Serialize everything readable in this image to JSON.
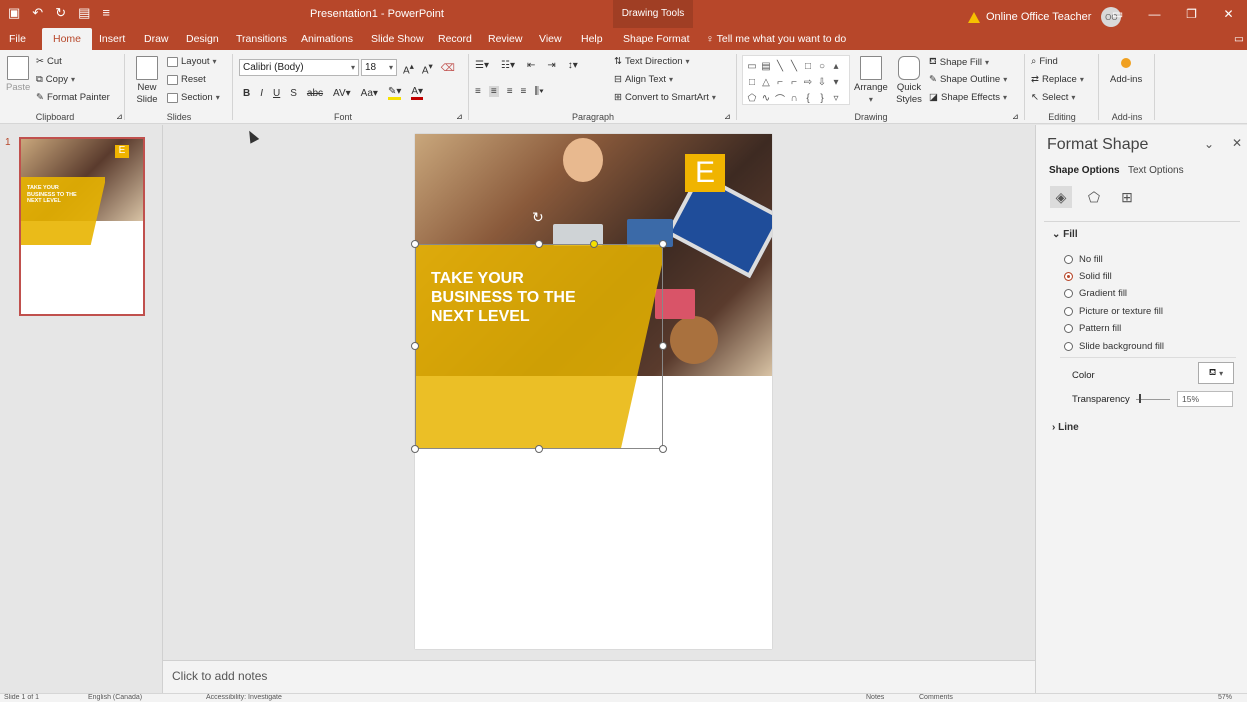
{
  "titlebar": {
    "doc_title": "Presentation1 - PowerPoint",
    "tool_group": "Drawing Tools",
    "user_name": "Online Office Teacher",
    "user_initials": "OO"
  },
  "tabs": [
    {
      "label": "File"
    },
    {
      "label": "Home",
      "active": true
    },
    {
      "label": "Insert"
    },
    {
      "label": "Draw"
    },
    {
      "label": "Design"
    },
    {
      "label": "Transitions"
    },
    {
      "label": "Animations"
    },
    {
      "label": "Slide Show"
    },
    {
      "label": "Record"
    },
    {
      "label": "Review"
    },
    {
      "label": "View"
    },
    {
      "label": "Help"
    },
    {
      "label": "Shape Format"
    }
  ],
  "tell_me": "Tell me what you want to do",
  "ribbon": {
    "clipboard": {
      "paste": "Paste",
      "cut": "Cut",
      "copy": "Copy",
      "format_painter": "Format Painter",
      "label": "Clipboard"
    },
    "slides": {
      "new_slide": "New Slide",
      "layout": "Layout",
      "reset": "Reset",
      "section": "Section",
      "label": "Slides"
    },
    "font": {
      "name": "Calibri (Body)",
      "size": "18",
      "label": "Font"
    },
    "paragraph": {
      "text_direction": "Text Direction",
      "align_text": "Align Text",
      "convert_smartart": "Convert to SmartArt",
      "label": "Paragraph"
    },
    "drawing": {
      "arrange": "Arrange",
      "quick_styles": "Quick Styles",
      "shape_fill": "Shape Fill",
      "shape_outline": "Shape Outline",
      "shape_effects": "Shape Effects",
      "label": "Drawing"
    },
    "editing": {
      "find": "Find",
      "replace": "Replace",
      "select": "Select",
      "label": "Editing"
    },
    "addins": {
      "button": "Add-ins",
      "label": "Add-ins"
    }
  },
  "thumbnails": [
    {
      "number": "1",
      "headline": "TAKE YOUR BUSINESS TO THE NEXT LEVEL"
    }
  ],
  "slide": {
    "headline_lines": [
      "TAKE YOUR",
      "BUSINESS TO THE",
      "NEXT LEVEL"
    ],
    "logo_letter": "E",
    "accent_color": "#E8B400"
  },
  "notes_placeholder": "Click to add notes",
  "format_pane": {
    "title": "Format Shape",
    "tabs": [
      "Shape Options",
      "Text Options"
    ],
    "fill_header": "Fill",
    "fill_options": [
      "No fill",
      "Solid fill",
      "Gradient fill",
      "Picture or texture fill",
      "Pattern fill",
      "Slide background fill"
    ],
    "selected_fill": "Solid fill",
    "color_label": "Color",
    "transparency_label": "Transparency",
    "transparency_value": "15%",
    "line_header": "Line"
  },
  "status": {
    "slide_info": "Slide 1 of 1",
    "language": "English (Canada)",
    "accessibility": "Accessibility: Investigate",
    "notes": "Notes",
    "comments": "Comments",
    "zoom": "57%"
  }
}
